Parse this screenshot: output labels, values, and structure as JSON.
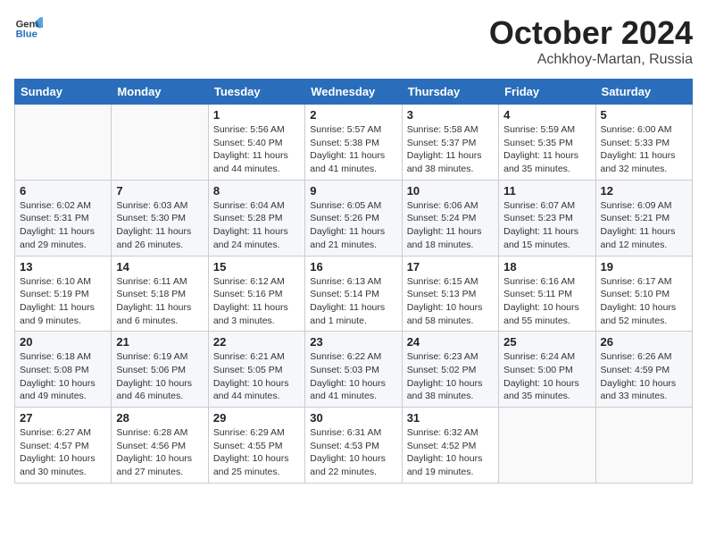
{
  "header": {
    "logo_general": "General",
    "logo_blue": "Blue",
    "main_title": "October 2024",
    "sub_title": "Achkhoy-Martan, Russia"
  },
  "columns": [
    "Sunday",
    "Monday",
    "Tuesday",
    "Wednesday",
    "Thursday",
    "Friday",
    "Saturday"
  ],
  "rows": [
    [
      {
        "day": "",
        "detail": ""
      },
      {
        "day": "",
        "detail": ""
      },
      {
        "day": "1",
        "detail": "Sunrise: 5:56 AM\nSunset: 5:40 PM\nDaylight: 11 hours and 44 minutes."
      },
      {
        "day": "2",
        "detail": "Sunrise: 5:57 AM\nSunset: 5:38 PM\nDaylight: 11 hours and 41 minutes."
      },
      {
        "day": "3",
        "detail": "Sunrise: 5:58 AM\nSunset: 5:37 PM\nDaylight: 11 hours and 38 minutes."
      },
      {
        "day": "4",
        "detail": "Sunrise: 5:59 AM\nSunset: 5:35 PM\nDaylight: 11 hours and 35 minutes."
      },
      {
        "day": "5",
        "detail": "Sunrise: 6:00 AM\nSunset: 5:33 PM\nDaylight: 11 hours and 32 minutes."
      }
    ],
    [
      {
        "day": "6",
        "detail": "Sunrise: 6:02 AM\nSunset: 5:31 PM\nDaylight: 11 hours and 29 minutes."
      },
      {
        "day": "7",
        "detail": "Sunrise: 6:03 AM\nSunset: 5:30 PM\nDaylight: 11 hours and 26 minutes."
      },
      {
        "day": "8",
        "detail": "Sunrise: 6:04 AM\nSunset: 5:28 PM\nDaylight: 11 hours and 24 minutes."
      },
      {
        "day": "9",
        "detail": "Sunrise: 6:05 AM\nSunset: 5:26 PM\nDaylight: 11 hours and 21 minutes."
      },
      {
        "day": "10",
        "detail": "Sunrise: 6:06 AM\nSunset: 5:24 PM\nDaylight: 11 hours and 18 minutes."
      },
      {
        "day": "11",
        "detail": "Sunrise: 6:07 AM\nSunset: 5:23 PM\nDaylight: 11 hours and 15 minutes."
      },
      {
        "day": "12",
        "detail": "Sunrise: 6:09 AM\nSunset: 5:21 PM\nDaylight: 11 hours and 12 minutes."
      }
    ],
    [
      {
        "day": "13",
        "detail": "Sunrise: 6:10 AM\nSunset: 5:19 PM\nDaylight: 11 hours and 9 minutes."
      },
      {
        "day": "14",
        "detail": "Sunrise: 6:11 AM\nSunset: 5:18 PM\nDaylight: 11 hours and 6 minutes."
      },
      {
        "day": "15",
        "detail": "Sunrise: 6:12 AM\nSunset: 5:16 PM\nDaylight: 11 hours and 3 minutes."
      },
      {
        "day": "16",
        "detail": "Sunrise: 6:13 AM\nSunset: 5:14 PM\nDaylight: 11 hours and 1 minute."
      },
      {
        "day": "17",
        "detail": "Sunrise: 6:15 AM\nSunset: 5:13 PM\nDaylight: 10 hours and 58 minutes."
      },
      {
        "day": "18",
        "detail": "Sunrise: 6:16 AM\nSunset: 5:11 PM\nDaylight: 10 hours and 55 minutes."
      },
      {
        "day": "19",
        "detail": "Sunrise: 6:17 AM\nSunset: 5:10 PM\nDaylight: 10 hours and 52 minutes."
      }
    ],
    [
      {
        "day": "20",
        "detail": "Sunrise: 6:18 AM\nSunset: 5:08 PM\nDaylight: 10 hours and 49 minutes."
      },
      {
        "day": "21",
        "detail": "Sunrise: 6:19 AM\nSunset: 5:06 PM\nDaylight: 10 hours and 46 minutes."
      },
      {
        "day": "22",
        "detail": "Sunrise: 6:21 AM\nSunset: 5:05 PM\nDaylight: 10 hours and 44 minutes."
      },
      {
        "day": "23",
        "detail": "Sunrise: 6:22 AM\nSunset: 5:03 PM\nDaylight: 10 hours and 41 minutes."
      },
      {
        "day": "24",
        "detail": "Sunrise: 6:23 AM\nSunset: 5:02 PM\nDaylight: 10 hours and 38 minutes."
      },
      {
        "day": "25",
        "detail": "Sunrise: 6:24 AM\nSunset: 5:00 PM\nDaylight: 10 hours and 35 minutes."
      },
      {
        "day": "26",
        "detail": "Sunrise: 6:26 AM\nSunset: 4:59 PM\nDaylight: 10 hours and 33 minutes."
      }
    ],
    [
      {
        "day": "27",
        "detail": "Sunrise: 6:27 AM\nSunset: 4:57 PM\nDaylight: 10 hours and 30 minutes."
      },
      {
        "day": "28",
        "detail": "Sunrise: 6:28 AM\nSunset: 4:56 PM\nDaylight: 10 hours and 27 minutes."
      },
      {
        "day": "29",
        "detail": "Sunrise: 6:29 AM\nSunset: 4:55 PM\nDaylight: 10 hours and 25 minutes."
      },
      {
        "day": "30",
        "detail": "Sunrise: 6:31 AM\nSunset: 4:53 PM\nDaylight: 10 hours and 22 minutes."
      },
      {
        "day": "31",
        "detail": "Sunrise: 6:32 AM\nSunset: 4:52 PM\nDaylight: 10 hours and 19 minutes."
      },
      {
        "day": "",
        "detail": ""
      },
      {
        "day": "",
        "detail": ""
      }
    ]
  ]
}
